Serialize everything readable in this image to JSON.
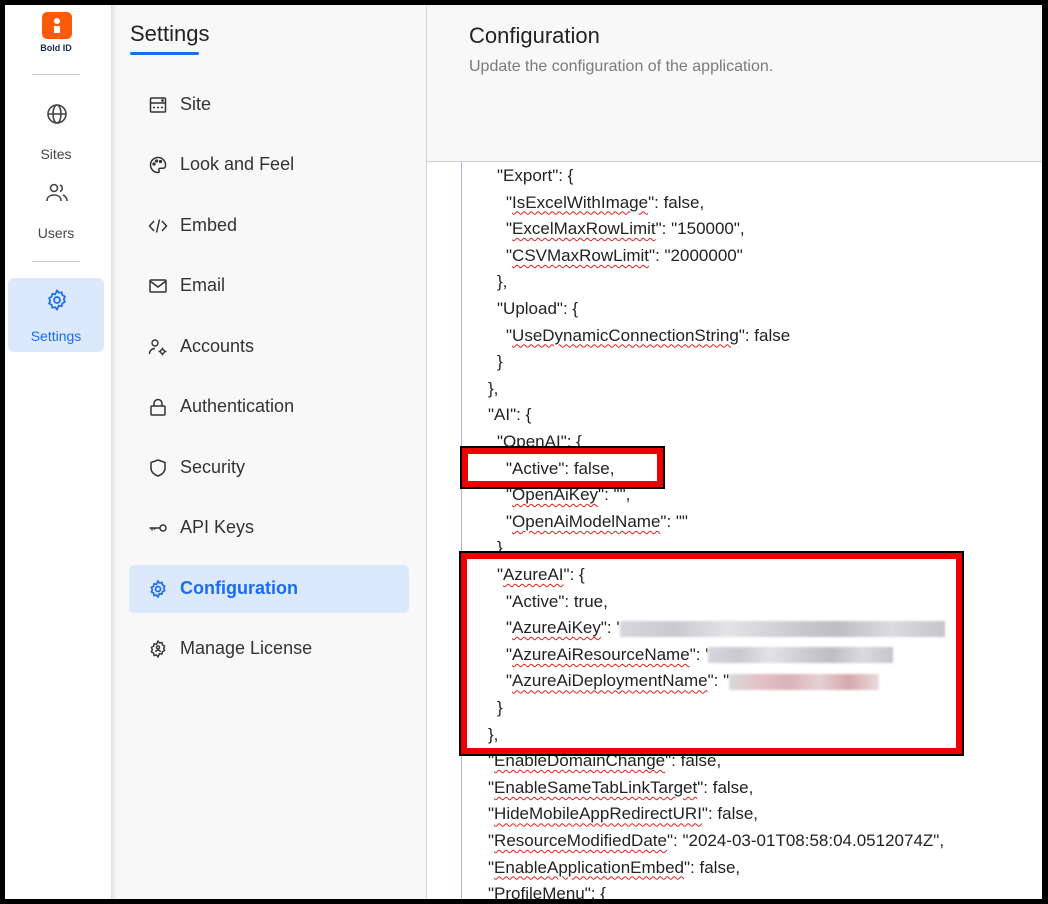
{
  "rail": {
    "logo_text": "Bold ID",
    "brand_color": "#ff5a0a",
    "items": [
      {
        "label": "Sites",
        "icon": "globe-icon"
      },
      {
        "label": "Users",
        "icon": "users-icon"
      },
      {
        "label": "Settings",
        "icon": "gear-icon",
        "active": true
      }
    ]
  },
  "sidebar": {
    "title": "Settings",
    "items": [
      {
        "label": "Site",
        "icon": "site-icon"
      },
      {
        "label": "Look and Feel",
        "icon": "palette-icon"
      },
      {
        "label": "Embed",
        "icon": "code-icon"
      },
      {
        "label": "Email",
        "icon": "mail-icon"
      },
      {
        "label": "Accounts",
        "icon": "user-gear-icon"
      },
      {
        "label": "Authentication",
        "icon": "lock-icon"
      },
      {
        "label": "Security",
        "icon": "shield-icon"
      },
      {
        "label": "API Keys",
        "icon": "key-icon"
      },
      {
        "label": "Configuration",
        "icon": "gear-icon",
        "active": true
      },
      {
        "label": "Manage License",
        "icon": "license-gear-icon"
      }
    ]
  },
  "main": {
    "title": "Configuration",
    "subtitle": "Update the configuration of the application.",
    "accent": "#1a6cf0",
    "code_lines": [
      {
        "indent": 1,
        "key": "Export",
        "rest": ": {",
        "squiggle": false
      },
      {
        "indent": 2,
        "key": "IsExcelWithImage",
        "rest": ": false,",
        "squiggle": true
      },
      {
        "indent": 2,
        "key": "ExcelMaxRowLimit",
        "rest": ": \"150000\",",
        "squiggle": true
      },
      {
        "indent": 2,
        "key": "CSVMaxRowLimit",
        "rest": ": \"2000000\"",
        "squiggle": true
      },
      {
        "indent": 1,
        "text": "},"
      },
      {
        "indent": 1,
        "key": "Upload",
        "rest": ": {",
        "squiggle": false
      },
      {
        "indent": 2,
        "key": "UseDynamicConnectionString",
        "rest": ": false",
        "squiggle": true
      },
      {
        "indent": 1,
        "text": "}"
      },
      {
        "indent": 0,
        "text": "},"
      },
      {
        "indent": 0,
        "key": "AI",
        "rest": ": {",
        "squiggle": false
      },
      {
        "indent": 1,
        "key": "OpenAI",
        "rest": ": {",
        "squiggle": false
      },
      {
        "indent": 2,
        "key": "Active",
        "rest": ": false,",
        "squiggle": false
      },
      {
        "indent": 2,
        "key": "OpenAiKey",
        "rest": ": \"\",",
        "squiggle": true
      },
      {
        "indent": 2,
        "key": "OpenAiModelName",
        "rest": ": \"\"",
        "squiggle": true
      },
      {
        "indent": 1,
        "text": "},"
      },
      {
        "indent": 1,
        "key": "AzureAI",
        "rest": ": {",
        "squiggle": true
      },
      {
        "indent": 2,
        "key": "Active",
        "rest": ": true,",
        "squiggle": false
      },
      {
        "indent": 2,
        "key": "AzureAiKey",
        "rest": ": '",
        "squiggle": true,
        "redacted": "wide"
      },
      {
        "indent": 2,
        "key": "AzureAiResourceName",
        "rest": ": '",
        "squiggle": true,
        "redacted": "mid"
      },
      {
        "indent": 2,
        "key": "AzureAiDeploymentName",
        "rest": ": \"",
        "squiggle": true,
        "redacted": "pink"
      },
      {
        "indent": 1,
        "text": "}"
      },
      {
        "indent": 0,
        "text": "},"
      },
      {
        "indent": 0,
        "key": "EnableDomainChange",
        "rest": ": false,",
        "squiggle": true
      },
      {
        "indent": 0,
        "key": "EnableSameTabLinkTarget",
        "rest": ": false,",
        "squiggle": true
      },
      {
        "indent": 0,
        "key": "HideMobileAppRedirectURI",
        "rest": ": false,",
        "squiggle": true
      },
      {
        "indent": 0,
        "key": "ResourceModifiedDate",
        "rest": ": \"2024-03-01T08:58:04.0512074Z\",",
        "squiggle": true
      },
      {
        "indent": 0,
        "key": "EnableApplicationEmbed",
        "rest": ": false,",
        "squiggle": true
      },
      {
        "indent": 0,
        "key": "ProfileMenu",
        "rest": ": {",
        "squiggle": true
      }
    ],
    "highlight_color": "#ee0000"
  }
}
